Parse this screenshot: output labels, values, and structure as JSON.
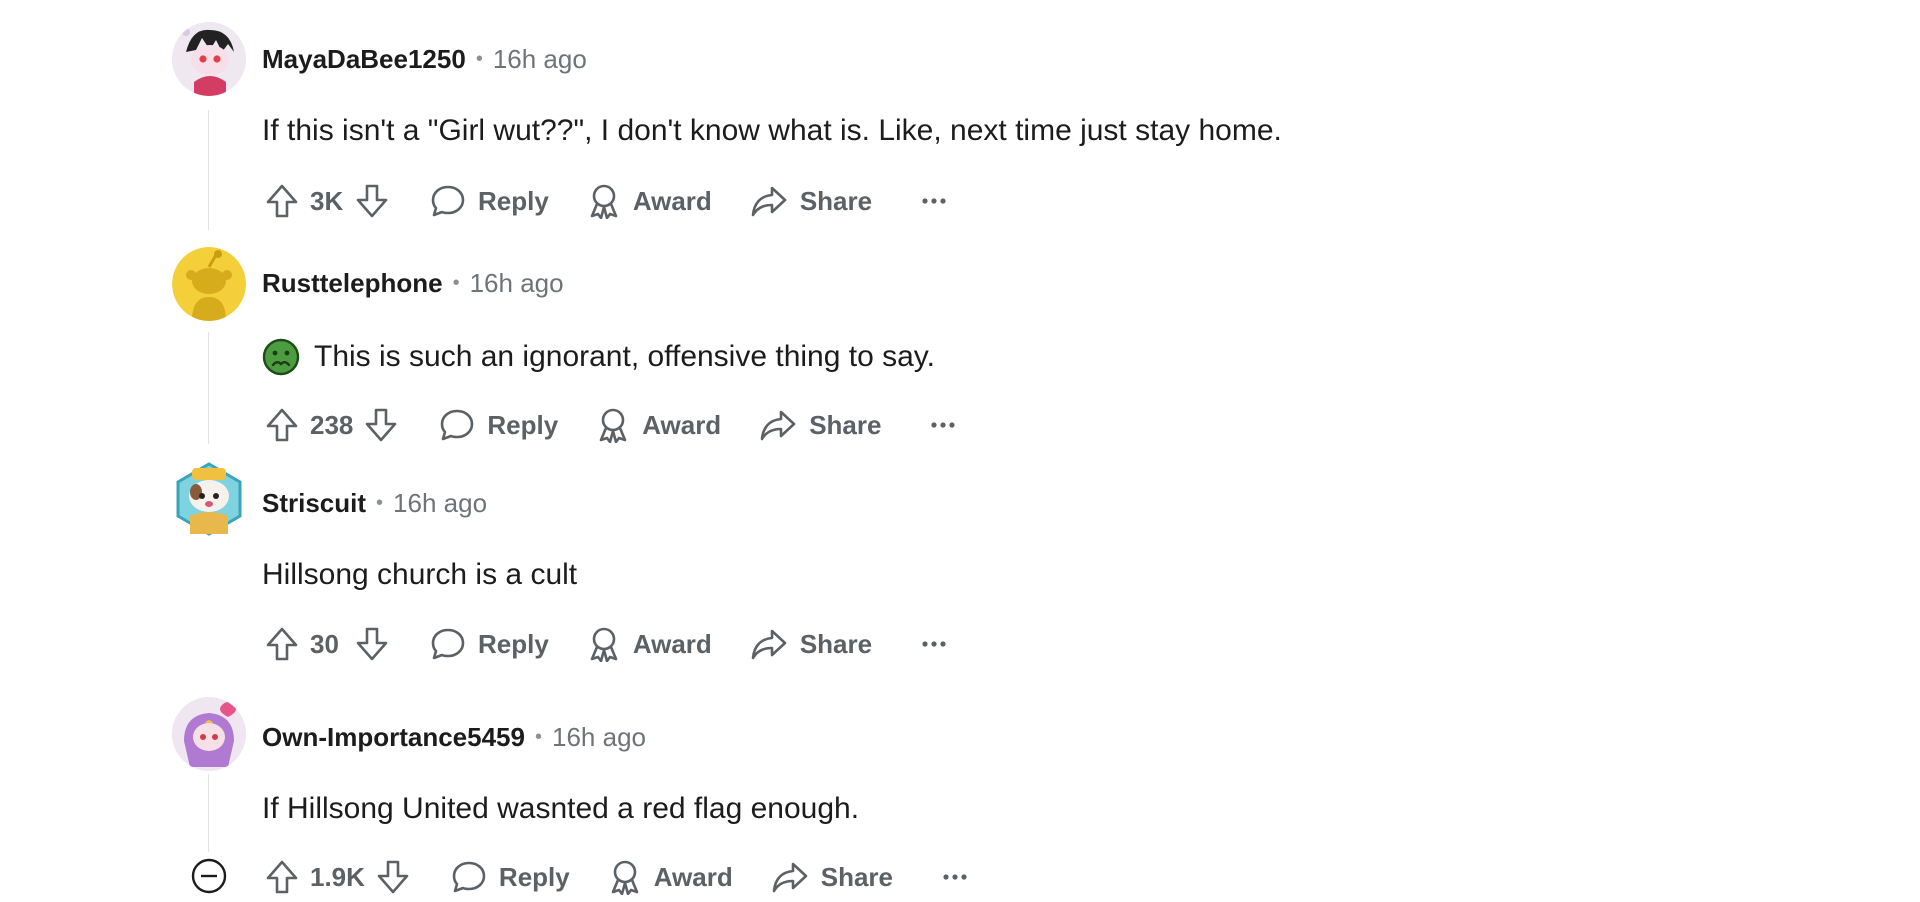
{
  "comments": [
    {
      "username": "MayaDaBee1250",
      "time": "16h ago",
      "body": "If this isn't a \"Girl wut??\", I don't know what is. Like, next time just stay home.",
      "score": "3K",
      "reply_label": "Reply",
      "award_label": "Award",
      "share_label": "Share"
    },
    {
      "username": "Rusttelephone",
      "time": "16h ago",
      "body": "This is such an ignorant, offensive thing to say.",
      "score": "238",
      "reply_label": "Reply",
      "award_label": "Award",
      "share_label": "Share"
    },
    {
      "username": "Striscuit",
      "time": "16h ago",
      "body": "Hillsong church is a cult",
      "score": "30",
      "reply_label": "Reply",
      "award_label": "Award",
      "share_label": "Share"
    },
    {
      "username": "Own-Importance5459",
      "time": "16h ago",
      "body": "If Hillsong United wasnted a red flag enough.",
      "score": "1.9K",
      "reply_label": "Reply",
      "award_label": "Award",
      "share_label": "Share"
    }
  ],
  "separator": "•",
  "icons": {
    "upvote": "upvote-icon",
    "downvote": "downvote-icon",
    "reply": "comment-bubble-icon",
    "award": "award-ribbon-icon",
    "share": "share-arrow-icon",
    "more": "ellipsis-icon",
    "collapse": "collapse-minus-icon",
    "emoji": "nauseated-face-emoji"
  },
  "colors": {
    "text": "#1c1c1c",
    "meta": "#6f7479",
    "action": "#5c6166",
    "thread_line": "#dfe3e6"
  }
}
